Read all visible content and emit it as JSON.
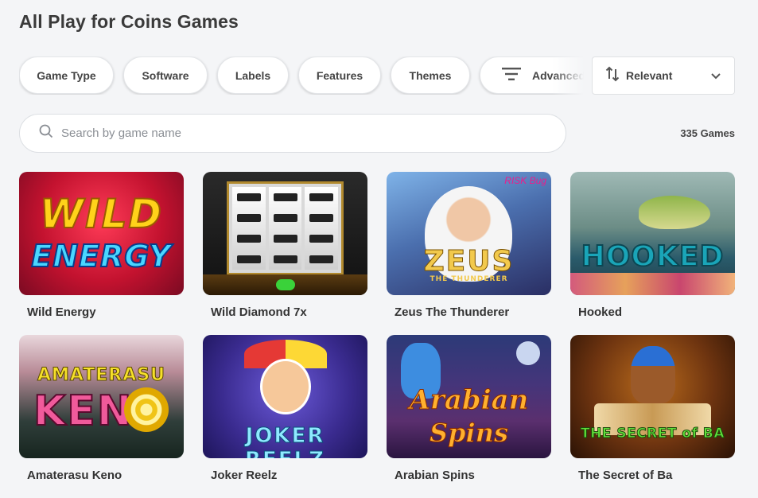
{
  "page": {
    "title": "All Play for Coins Games"
  },
  "filters": {
    "game_type": "Game Type",
    "software": "Software",
    "labels": "Labels",
    "features": "Features",
    "themes": "Themes",
    "advanced": "Advanced"
  },
  "sort": {
    "selected": "Relevant"
  },
  "search": {
    "placeholder": "Search by game name",
    "value": ""
  },
  "results": {
    "count_label": "335 Games"
  },
  "games": [
    {
      "title": "Wild Energy",
      "art_line1": "WILD",
      "art_line2": "ENERGY"
    },
    {
      "title": "Wild Diamond 7x"
    },
    {
      "title": "Zeus The Thunderer",
      "art_line1": "ZEUS",
      "art_line2": "THE THUNDERER",
      "badge": "RISK Bug"
    },
    {
      "title": "Hooked",
      "art_line1": "HOOKED"
    },
    {
      "title": "Amaterasu Keno",
      "art_line1": "AMATERASU",
      "art_line2": "KEN"
    },
    {
      "title": "Joker Reelz",
      "art_line1": "JOKER REELZ"
    },
    {
      "title": "Arabian Spins",
      "art_line1": "Arabian",
      "art_line2": "Spins"
    },
    {
      "title": "The Secret of Ba",
      "art_line1": "THE SECRET of BA"
    }
  ],
  "icons": {
    "advanced": "filter-lines-icon",
    "sort": "sort-arrows-icon",
    "dropdown": "chevron-down-icon",
    "search": "search-icon"
  }
}
